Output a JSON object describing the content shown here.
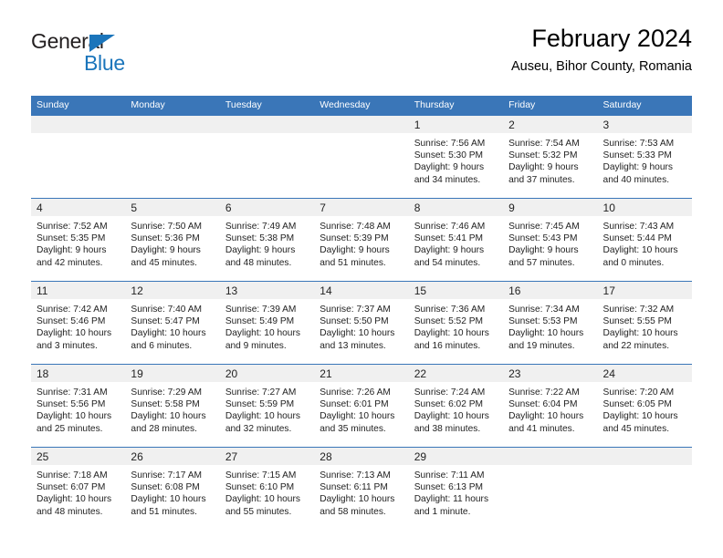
{
  "brand": {
    "name_part1": "General",
    "name_part2": "Blue",
    "triangle_color": "#1b75bb"
  },
  "header": {
    "title": "February 2024",
    "subtitle": "Auseu, Bihor County, Romania"
  },
  "theme": {
    "header_blue": "#3a76b8",
    "daystrip_gray": "#f0f0f0",
    "text": "#222222"
  },
  "weekday_headers": [
    "Sunday",
    "Monday",
    "Tuesday",
    "Wednesday",
    "Thursday",
    "Friday",
    "Saturday"
  ],
  "labels": {
    "sunrise_prefix": "Sunrise:",
    "sunset_prefix": "Sunset:",
    "daylight_prefix": "Daylight:"
  },
  "weeks": [
    [
      {
        "day": "",
        "empty": true
      },
      {
        "day": "",
        "empty": true
      },
      {
        "day": "",
        "empty": true
      },
      {
        "day": "",
        "empty": true
      },
      {
        "day": "1",
        "sunrise": "Sunrise: 7:56 AM",
        "sunset": "Sunset: 5:30 PM",
        "daylight_l1": "Daylight: 9 hours",
        "daylight_l2": "and 34 minutes."
      },
      {
        "day": "2",
        "sunrise": "Sunrise: 7:54 AM",
        "sunset": "Sunset: 5:32 PM",
        "daylight_l1": "Daylight: 9 hours",
        "daylight_l2": "and 37 minutes."
      },
      {
        "day": "3",
        "sunrise": "Sunrise: 7:53 AM",
        "sunset": "Sunset: 5:33 PM",
        "daylight_l1": "Daylight: 9 hours",
        "daylight_l2": "and 40 minutes."
      }
    ],
    [
      {
        "day": "4",
        "sunrise": "Sunrise: 7:52 AM",
        "sunset": "Sunset: 5:35 PM",
        "daylight_l1": "Daylight: 9 hours",
        "daylight_l2": "and 42 minutes."
      },
      {
        "day": "5",
        "sunrise": "Sunrise: 7:50 AM",
        "sunset": "Sunset: 5:36 PM",
        "daylight_l1": "Daylight: 9 hours",
        "daylight_l2": "and 45 minutes."
      },
      {
        "day": "6",
        "sunrise": "Sunrise: 7:49 AM",
        "sunset": "Sunset: 5:38 PM",
        "daylight_l1": "Daylight: 9 hours",
        "daylight_l2": "and 48 minutes."
      },
      {
        "day": "7",
        "sunrise": "Sunrise: 7:48 AM",
        "sunset": "Sunset: 5:39 PM",
        "daylight_l1": "Daylight: 9 hours",
        "daylight_l2": "and 51 minutes."
      },
      {
        "day": "8",
        "sunrise": "Sunrise: 7:46 AM",
        "sunset": "Sunset: 5:41 PM",
        "daylight_l1": "Daylight: 9 hours",
        "daylight_l2": "and 54 minutes."
      },
      {
        "day": "9",
        "sunrise": "Sunrise: 7:45 AM",
        "sunset": "Sunset: 5:43 PM",
        "daylight_l1": "Daylight: 9 hours",
        "daylight_l2": "and 57 minutes."
      },
      {
        "day": "10",
        "sunrise": "Sunrise: 7:43 AM",
        "sunset": "Sunset: 5:44 PM",
        "daylight_l1": "Daylight: 10 hours",
        "daylight_l2": "and 0 minutes."
      }
    ],
    [
      {
        "day": "11",
        "sunrise": "Sunrise: 7:42 AM",
        "sunset": "Sunset: 5:46 PM",
        "daylight_l1": "Daylight: 10 hours",
        "daylight_l2": "and 3 minutes."
      },
      {
        "day": "12",
        "sunrise": "Sunrise: 7:40 AM",
        "sunset": "Sunset: 5:47 PM",
        "daylight_l1": "Daylight: 10 hours",
        "daylight_l2": "and 6 minutes."
      },
      {
        "day": "13",
        "sunrise": "Sunrise: 7:39 AM",
        "sunset": "Sunset: 5:49 PM",
        "daylight_l1": "Daylight: 10 hours",
        "daylight_l2": "and 9 minutes."
      },
      {
        "day": "14",
        "sunrise": "Sunrise: 7:37 AM",
        "sunset": "Sunset: 5:50 PM",
        "daylight_l1": "Daylight: 10 hours",
        "daylight_l2": "and 13 minutes."
      },
      {
        "day": "15",
        "sunrise": "Sunrise: 7:36 AM",
        "sunset": "Sunset: 5:52 PM",
        "daylight_l1": "Daylight: 10 hours",
        "daylight_l2": "and 16 minutes."
      },
      {
        "day": "16",
        "sunrise": "Sunrise: 7:34 AM",
        "sunset": "Sunset: 5:53 PM",
        "daylight_l1": "Daylight: 10 hours",
        "daylight_l2": "and 19 minutes."
      },
      {
        "day": "17",
        "sunrise": "Sunrise: 7:32 AM",
        "sunset": "Sunset: 5:55 PM",
        "daylight_l1": "Daylight: 10 hours",
        "daylight_l2": "and 22 minutes."
      }
    ],
    [
      {
        "day": "18",
        "sunrise": "Sunrise: 7:31 AM",
        "sunset": "Sunset: 5:56 PM",
        "daylight_l1": "Daylight: 10 hours",
        "daylight_l2": "and 25 minutes."
      },
      {
        "day": "19",
        "sunrise": "Sunrise: 7:29 AM",
        "sunset": "Sunset: 5:58 PM",
        "daylight_l1": "Daylight: 10 hours",
        "daylight_l2": "and 28 minutes."
      },
      {
        "day": "20",
        "sunrise": "Sunrise: 7:27 AM",
        "sunset": "Sunset: 5:59 PM",
        "daylight_l1": "Daylight: 10 hours",
        "daylight_l2": "and 32 minutes."
      },
      {
        "day": "21",
        "sunrise": "Sunrise: 7:26 AM",
        "sunset": "Sunset: 6:01 PM",
        "daylight_l1": "Daylight: 10 hours",
        "daylight_l2": "and 35 minutes."
      },
      {
        "day": "22",
        "sunrise": "Sunrise: 7:24 AM",
        "sunset": "Sunset: 6:02 PM",
        "daylight_l1": "Daylight: 10 hours",
        "daylight_l2": "and 38 minutes."
      },
      {
        "day": "23",
        "sunrise": "Sunrise: 7:22 AM",
        "sunset": "Sunset: 6:04 PM",
        "daylight_l1": "Daylight: 10 hours",
        "daylight_l2": "and 41 minutes."
      },
      {
        "day": "24",
        "sunrise": "Sunrise: 7:20 AM",
        "sunset": "Sunset: 6:05 PM",
        "daylight_l1": "Daylight: 10 hours",
        "daylight_l2": "and 45 minutes."
      }
    ],
    [
      {
        "day": "25",
        "sunrise": "Sunrise: 7:18 AM",
        "sunset": "Sunset: 6:07 PM",
        "daylight_l1": "Daylight: 10 hours",
        "daylight_l2": "and 48 minutes."
      },
      {
        "day": "26",
        "sunrise": "Sunrise: 7:17 AM",
        "sunset": "Sunset: 6:08 PM",
        "daylight_l1": "Daylight: 10 hours",
        "daylight_l2": "and 51 minutes."
      },
      {
        "day": "27",
        "sunrise": "Sunrise: 7:15 AM",
        "sunset": "Sunset: 6:10 PM",
        "daylight_l1": "Daylight: 10 hours",
        "daylight_l2": "and 55 minutes."
      },
      {
        "day": "28",
        "sunrise": "Sunrise: 7:13 AM",
        "sunset": "Sunset: 6:11 PM",
        "daylight_l1": "Daylight: 10 hours",
        "daylight_l2": "and 58 minutes."
      },
      {
        "day": "29",
        "sunrise": "Sunrise: 7:11 AM",
        "sunset": "Sunset: 6:13 PM",
        "daylight_l1": "Daylight: 11 hours",
        "daylight_l2": "and 1 minute."
      },
      {
        "day": "",
        "empty": true
      },
      {
        "day": "",
        "empty": true
      }
    ]
  ]
}
